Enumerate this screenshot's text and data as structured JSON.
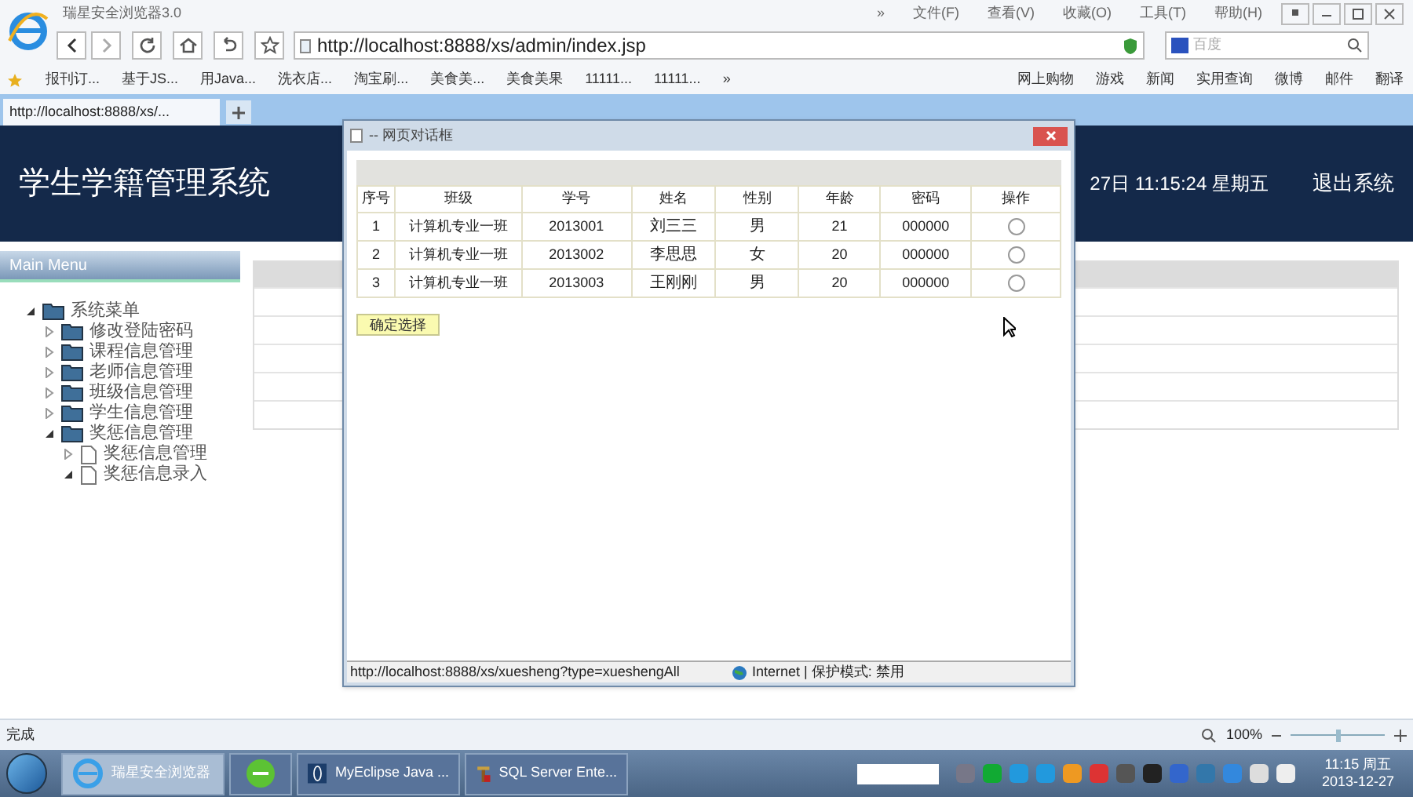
{
  "browser": {
    "title": "瑞星安全浏览器3.0",
    "menu": [
      "»",
      "文件(F)",
      "查看(V)",
      "收藏(O)",
      "工具(T)",
      "帮助(H)"
    ],
    "address": "http://localhost:8888/xs/admin/index.jsp",
    "search": {
      "placeholder": "百度"
    },
    "bookmarks": [
      "报刊订...",
      "基于JS...",
      "用Java...",
      "洗衣店...",
      "淘宝刷...",
      "美食美...",
      "美食美果",
      "11111...",
      "11111...",
      "»"
    ],
    "bookmarks_right": [
      "网上购物",
      "游戏",
      "新闻",
      "实用查询",
      "微博",
      "邮件",
      "翻译"
    ],
    "tabs": [
      {
        "label": "http://localhost:8888/xs/...",
        "selected": true
      }
    ]
  },
  "page": {
    "title": "学生学籍管理系统",
    "clock": "27日 11:15:24 星期五",
    "logout": "退出系统",
    "menu_title": "Main Menu",
    "tree": [
      {
        "label": "系统菜单",
        "expanded": true,
        "children": [
          {
            "label": "修改登陆密码",
            "expanded": false
          },
          {
            "label": "课程信息管理",
            "expanded": false
          },
          {
            "label": "老师信息管理",
            "expanded": false
          },
          {
            "label": "班级信息管理",
            "expanded": false
          },
          {
            "label": "学生信息管理",
            "expanded": false
          },
          {
            "label": "奖惩信息管理",
            "expanded": true,
            "children": [
              {
                "label": "奖惩信息管理",
                "kind": "page",
                "expanded": false
              },
              {
                "label": "奖惩信息录入",
                "kind": "page",
                "expanded": true
              }
            ]
          }
        ]
      }
    ]
  },
  "dialog": {
    "title": "-- 网页对话框",
    "columns": [
      "序号",
      "班级",
      "学号",
      "姓名",
      "性别",
      "年龄",
      "密码",
      "操作"
    ],
    "rows": [
      {
        "cells": [
          "1",
          "计算机专业一班",
          "2013001",
          "刘三三",
          "男",
          "21",
          "000000"
        ],
        "selected": false
      },
      {
        "cells": [
          "2",
          "计算机专业一班",
          "2013002",
          "李思思",
          "女",
          "20",
          "000000"
        ],
        "selected": false
      },
      {
        "cells": [
          "3",
          "计算机专业一班",
          "2013003",
          "王刚刚",
          "男",
          "20",
          "000000"
        ],
        "selected": false
      }
    ],
    "button": "确定选择",
    "status_url": "http://localhost:8888/xs/xuesheng?type=xueshengAll",
    "status_zone": "Internet | 保护模式: 禁用"
  },
  "status_bar": {
    "text": "完成",
    "zoom": "100%",
    "zoom_slider": {
      "level": 0.5
    }
  },
  "taskbar": {
    "items": [
      {
        "kind": "browser",
        "label": "瑞星安全浏览器",
        "selected": true
      },
      {
        "kind": "green",
        "selected": false
      },
      {
        "kind": "eclipse",
        "label": "MyEclipse Java ...",
        "selected": false
      },
      {
        "kind": "sql",
        "label": "SQL Server Ente...",
        "selected": false
      }
    ],
    "time": "11:15 周五",
    "date": "2013-12-27"
  }
}
